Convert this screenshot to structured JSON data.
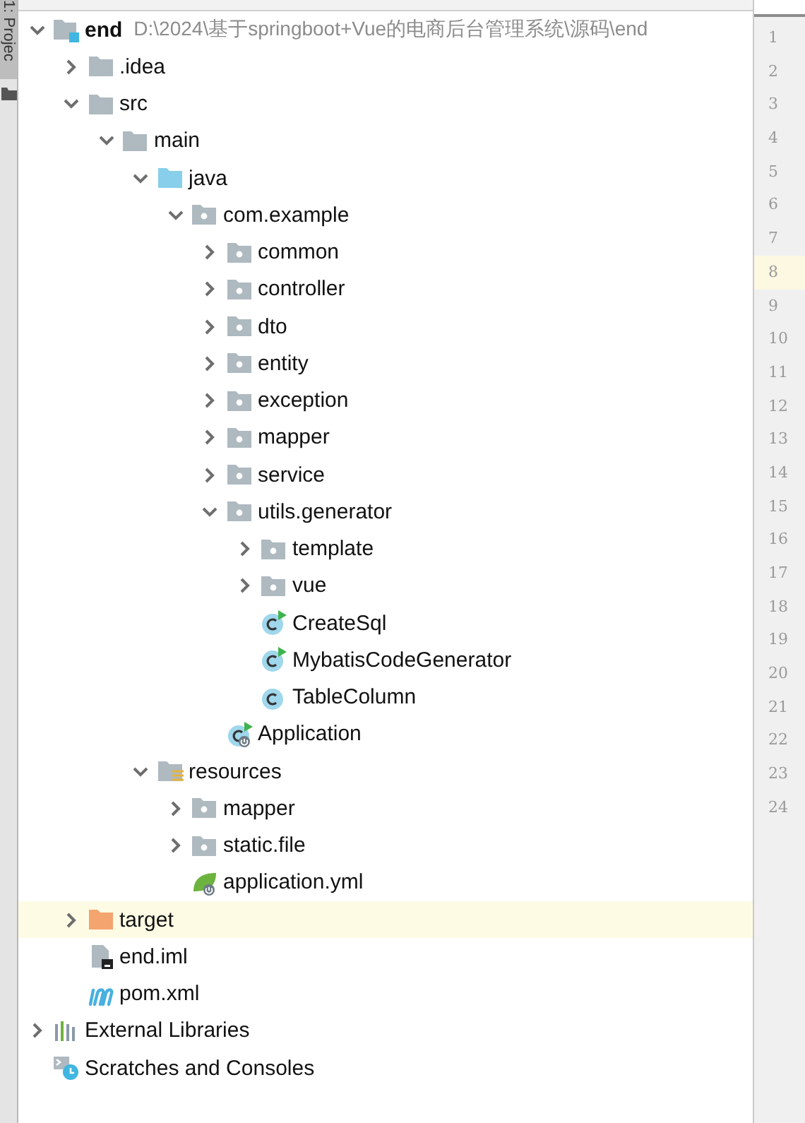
{
  "side_tab": {
    "label": "1: Projec"
  },
  "tree": [
    {
      "name": "end",
      "path": "D:\\2024\\基于springboot+Vue的电商后台管理系统\\源码\\end",
      "kind": "module",
      "expanded": true,
      "selected": false,
      "children": [
        {
          "name": ".idea",
          "kind": "folder",
          "expanded": false,
          "selected": false
        },
        {
          "name": "src",
          "kind": "folder",
          "expanded": true,
          "selected": false,
          "children": [
            {
              "name": "main",
              "kind": "folder",
              "expanded": true,
              "selected": false,
              "children": [
                {
                  "name": "java",
                  "kind": "source",
                  "expanded": true,
                  "selected": false,
                  "children": [
                    {
                      "name": "com.example",
                      "kind": "package",
                      "expanded": true,
                      "selected": false,
                      "children": [
                        {
                          "name": "common",
                          "kind": "package",
                          "expanded": false,
                          "selected": false
                        },
                        {
                          "name": "controller",
                          "kind": "package",
                          "expanded": false,
                          "selected": false
                        },
                        {
                          "name": "dto",
                          "kind": "package",
                          "expanded": false,
                          "selected": false
                        },
                        {
                          "name": "entity",
                          "kind": "package",
                          "expanded": false,
                          "selected": false
                        },
                        {
                          "name": "exception",
                          "kind": "package",
                          "expanded": false,
                          "selected": false
                        },
                        {
                          "name": "mapper",
                          "kind": "package",
                          "expanded": false,
                          "selected": false
                        },
                        {
                          "name": "service",
                          "kind": "package",
                          "expanded": false,
                          "selected": false
                        },
                        {
                          "name": "utils.generator",
                          "kind": "package",
                          "expanded": true,
                          "selected": false,
                          "children": [
                            {
                              "name": "template",
                              "kind": "package",
                              "expanded": false,
                              "selected": false
                            },
                            {
                              "name": "vue",
                              "kind": "package",
                              "expanded": false,
                              "selected": false
                            },
                            {
                              "name": "CreateSql",
                              "kind": "runnable",
                              "selected": false
                            },
                            {
                              "name": "MybatisCodeGenerator",
                              "kind": "runnable",
                              "selected": false
                            },
                            {
                              "name": "TableColumn",
                              "kind": "class",
                              "selected": false
                            }
                          ]
                        },
                        {
                          "name": "Application",
                          "kind": "spring-runnable",
                          "selected": false
                        }
                      ]
                    }
                  ]
                },
                {
                  "name": "resources",
                  "kind": "resources",
                  "expanded": true,
                  "selected": false,
                  "children": [
                    {
                      "name": "mapper",
                      "kind": "package",
                      "expanded": false,
                      "selected": false
                    },
                    {
                      "name": "static.file",
                      "kind": "package",
                      "expanded": false,
                      "selected": false
                    },
                    {
                      "name": "application.yml",
                      "kind": "yml",
                      "selected": false
                    }
                  ]
                }
              ]
            }
          ]
        },
        {
          "name": "target",
          "kind": "excluded",
          "expanded": false,
          "selected": true
        },
        {
          "name": "end.iml",
          "kind": "iml",
          "selected": false
        },
        {
          "name": "pom.xml",
          "kind": "maven",
          "selected": false
        }
      ]
    },
    {
      "name": "External Libraries",
      "kind": "libraries",
      "expanded": false,
      "selected": false
    },
    {
      "name": "Scratches and Consoles",
      "kind": "scratches",
      "selected": false
    }
  ],
  "gutter": [
    {
      "number": "1",
      "current": false
    },
    {
      "number": "2",
      "current": false
    },
    {
      "number": "3",
      "current": false
    },
    {
      "number": "4",
      "current": false
    },
    {
      "number": "5",
      "current": false
    },
    {
      "number": "6",
      "current": false
    },
    {
      "number": "7",
      "current": false
    },
    {
      "number": "8",
      "current": true
    },
    {
      "number": "9",
      "current": false
    },
    {
      "number": "10",
      "current": false
    },
    {
      "number": "11",
      "current": false
    },
    {
      "number": "12",
      "current": false
    },
    {
      "number": "13",
      "current": false
    },
    {
      "number": "14",
      "current": false
    },
    {
      "number": "15",
      "current": false
    },
    {
      "number": "16",
      "current": false
    },
    {
      "number": "17",
      "current": false
    },
    {
      "number": "18",
      "current": false
    },
    {
      "number": "19",
      "current": false
    },
    {
      "number": "20",
      "current": false
    },
    {
      "number": "21",
      "current": false
    },
    {
      "number": "22",
      "current": false
    },
    {
      "number": "23",
      "current": false
    },
    {
      "number": "24",
      "current": false
    }
  ]
}
